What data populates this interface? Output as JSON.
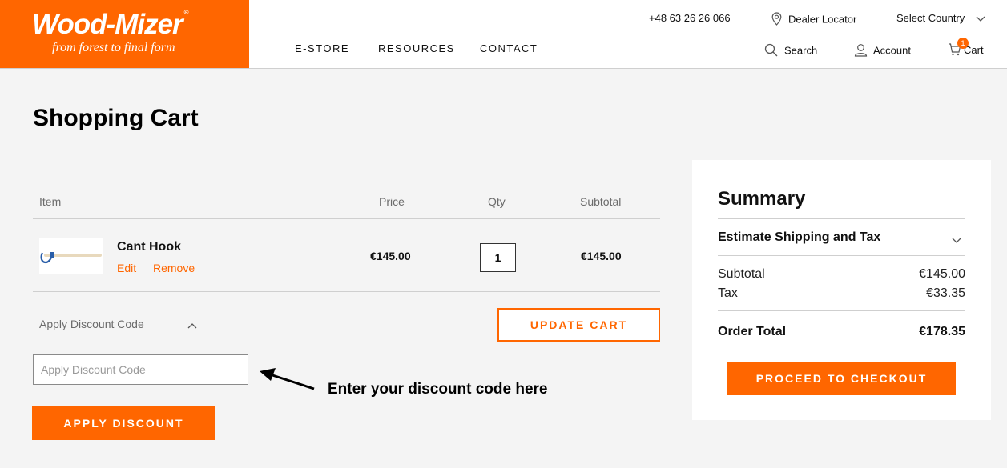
{
  "brand": {
    "name": "Wood-Mizer",
    "tagline": "from forest to final form",
    "accent": "#ff6600"
  },
  "topbar": {
    "phone": "+48 63 26 26 066",
    "dealer_locator": "Dealer Locator",
    "select_country": "Select Country"
  },
  "nav": {
    "items": [
      "E-STORE",
      "RESOURCES",
      "CONTACT"
    ]
  },
  "utility": {
    "search": "Search",
    "account": "Account",
    "cart": "Cart",
    "cart_count": "1"
  },
  "page_title": "Shopping Cart",
  "cart_table": {
    "headers": {
      "item": "Item",
      "price": "Price",
      "qty": "Qty",
      "subtotal": "Subtotal"
    },
    "rows": [
      {
        "name": "Cant Hook",
        "edit": "Edit",
        "remove": "Remove",
        "price": "€145.00",
        "qty": "1",
        "subtotal": "€145.00"
      }
    ]
  },
  "discount": {
    "toggle_label": "Apply Discount Code",
    "input_placeholder": "Apply Discount Code",
    "apply_button": "APPLY DISCOUNT",
    "annotation": "Enter your discount code here"
  },
  "update_cart_button": "UPDATE CART",
  "summary": {
    "title": "Summary",
    "shipping_toggle": "Estimate Shipping and Tax",
    "subtotal_label": "Subtotal",
    "subtotal_value": "€145.00",
    "tax_label": "Tax",
    "tax_value": "€33.35",
    "total_label": "Order Total",
    "total_value": "€178.35",
    "checkout_button": "PROCEED TO CHECKOUT"
  }
}
